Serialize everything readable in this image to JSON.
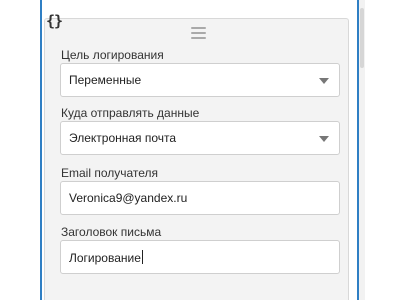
{
  "panel": {
    "code_glyph": "{}",
    "fields": [
      {
        "label": "Цель логирования",
        "value": "Переменные",
        "type": "select"
      },
      {
        "label": "Куда отправлять данные",
        "value": "Электронная почта",
        "type": "select"
      },
      {
        "label": "Email получателя",
        "value": "Veronica9@yandex.ru",
        "type": "text"
      },
      {
        "label": "Заголовок письма",
        "value": "Логирование",
        "type": "text"
      }
    ]
  },
  "colors": {
    "accent_rule": "#2f7fc4",
    "panel_bg": "#f3f3f3"
  }
}
